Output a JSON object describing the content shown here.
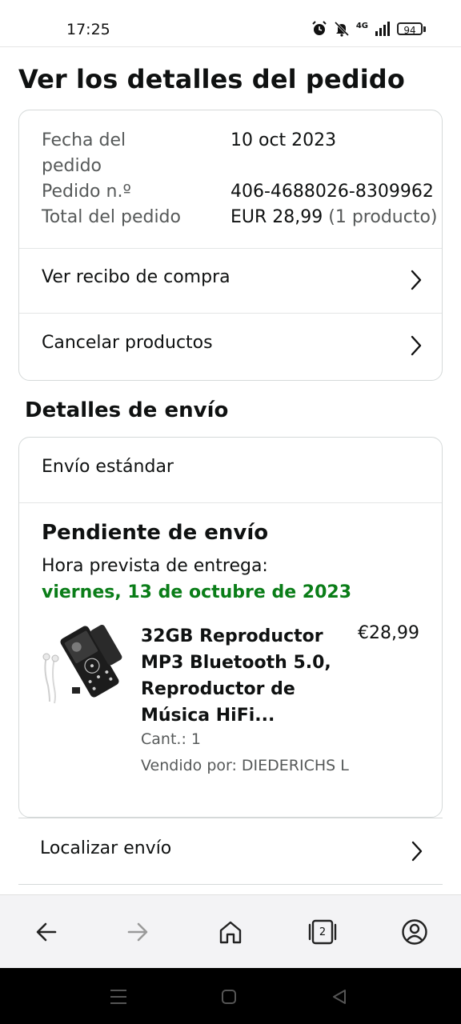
{
  "status_bar": {
    "time": "17:25",
    "network": "4G",
    "battery": "94"
  },
  "page": {
    "title": "Ver los detalles del pedido"
  },
  "order": {
    "date_label": "Fecha del pedido",
    "date_value": "10 oct 2023",
    "number_label": "Pedido n.º",
    "number_value": "406-4688026-8309962",
    "total_label": "Total del pedido",
    "total_value": "EUR 28,99",
    "total_count": "(1 producto)",
    "receipt_link": "Ver recibo de compra",
    "cancel_link": "Cancelar productos"
  },
  "shipping": {
    "section_title": "Detalles de envío",
    "method": "Envío estándar",
    "status": "Pendiente de envío",
    "eta_label": "Hora prevista de entrega:",
    "eta_date": "viernes, 13 de octubre de 2023",
    "eta_color": "#0a7d18",
    "product": {
      "name": "32GB Reproductor MP3 Bluetooth 5.0, Reproductor de Música HiFi...",
      "price": "€28,99",
      "quantity": "Cant.: 1",
      "seller": "Vendido por: DIEDERICHS L"
    },
    "track_link": "Localizar envío"
  },
  "bottom_nav": {
    "tab_count": "2",
    "icons": [
      "back-arrow-icon",
      "forward-arrow-icon",
      "home-icon",
      "tabs-icon",
      "account-icon"
    ]
  },
  "system_nav": {
    "icons": [
      "menu-icon",
      "home-square-icon",
      "back-triangle-icon"
    ]
  }
}
